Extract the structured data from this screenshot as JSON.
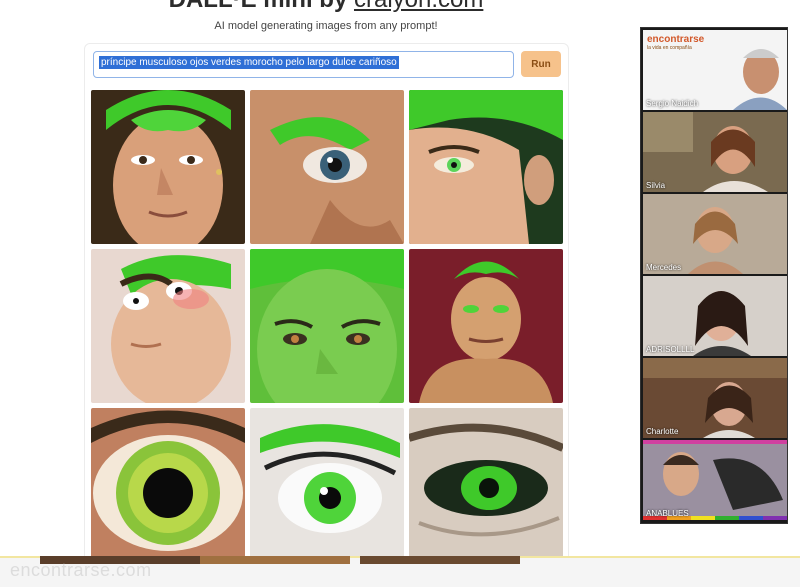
{
  "header": {
    "title_prefix": "DALL·E mini by ",
    "title_link": "craiyon.com",
    "subtitle": "AI model generating images from any prompt!"
  },
  "prompt": {
    "value": "príncipe musculoso ojos verdes morocho pelo largo dulce cariñoso"
  },
  "run_button": {
    "label": "Run"
  },
  "grid": {
    "accent": "#3fc92a",
    "tiles": [
      {
        "subject": "face-green-hair"
      },
      {
        "subject": "eye-closeup"
      },
      {
        "subject": "face-green-eye"
      },
      {
        "subject": "cartoon-face"
      },
      {
        "subject": "green-face"
      },
      {
        "subject": "muscular-hero"
      },
      {
        "subject": "iris-closeup"
      },
      {
        "subject": "eye-lashes"
      },
      {
        "subject": "green-eye"
      }
    ]
  },
  "video_call": {
    "logo": "encontrarse",
    "logo_tagline": "la vida en compañía",
    "participants": [
      {
        "name": "Sergio Naidich"
      },
      {
        "name": "Silvia"
      },
      {
        "name": "Mercedes"
      },
      {
        "name": "ADRISOLLLL"
      },
      {
        "name": "Charlotte"
      },
      {
        "name": "ANABLUES"
      }
    ]
  },
  "watermark": {
    "text": "encontrarse.com"
  }
}
